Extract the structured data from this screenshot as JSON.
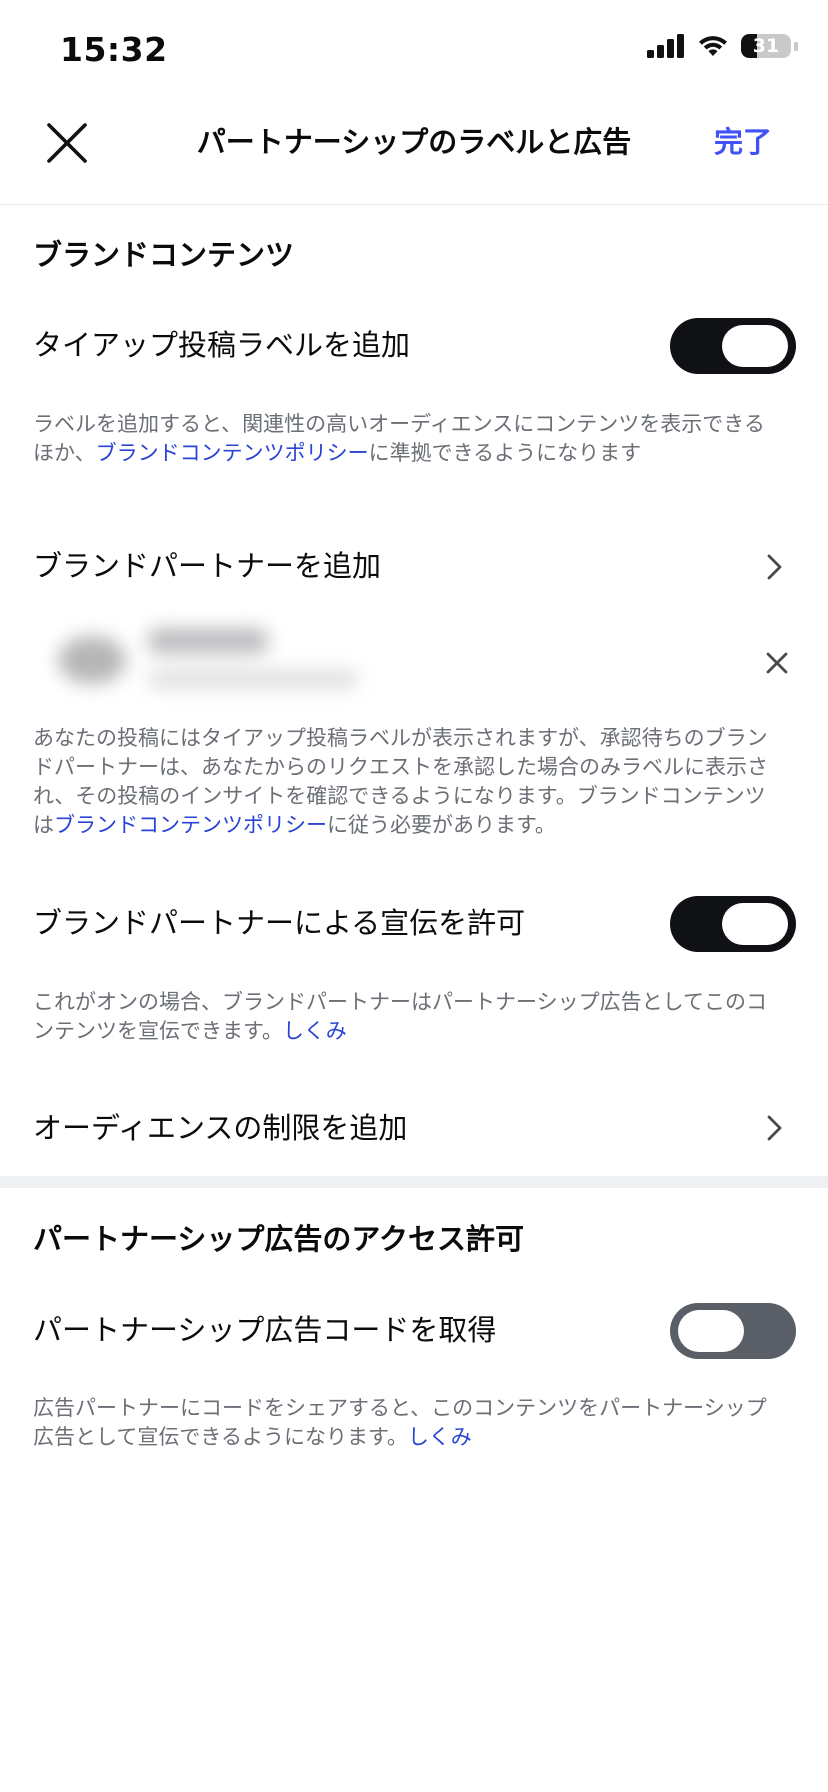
{
  "status_bar": {
    "time": "15:32",
    "battery": "31",
    "battery_level_percent": 31,
    "icons": [
      "signal-icon",
      "wifi-icon",
      "battery-icon"
    ]
  },
  "header": {
    "title": "パートナーシップのラベルと広告",
    "done_label": "完了",
    "close_icon": "close-icon"
  },
  "branded_content": {
    "heading": "ブランドコンテンツ",
    "paid_partnership_label": {
      "label": "タイアップ投稿ラベルを追加",
      "enabled": true,
      "description_before": "ラベルを追加すると、関連性の高いオーディエンスにコンテンツを表示できるほか、",
      "description_link": "ブランドコンテンツポリシー",
      "description_after": "に準拠できるようになります"
    },
    "add_brand_partner": {
      "label": "ブランドパートナーを追加",
      "description_before": "あなたの投稿にはタイアップ投稿ラベルが表示されますが、承認待ちのブランドパートナーは、あなたからのリクエストを承認した場合のみラベルに表示され、その投稿のインサイトを確認できるようになります。ブランドコンテンツは",
      "description_link": "ブランドコンテンツポリシー",
      "description_after": "に従う必要があります。"
    },
    "allow_partner_promotion": {
      "label": "ブランドパートナーによる宣伝を許可",
      "enabled": true,
      "description_before": "これがオンの場合、ブランドパートナーはパートナーシップ広告としてこのコンテンツを宣伝できます。",
      "description_link": "しくみ"
    },
    "audience_restriction": {
      "label": "オーディエンスの制限を追加"
    }
  },
  "partnership_ads": {
    "heading": "パートナーシップ広告のアクセス許可",
    "get_ad_code": {
      "label": "パートナーシップ広告コードを取得",
      "enabled": false,
      "description_before": "広告パートナーにコードをシェアすると、このコンテンツをパートナーシップ広告として宣伝できるようになります。",
      "description_link": "しくみ"
    }
  },
  "colors": {
    "accent": "#4150f7",
    "link": "#2a44d6",
    "toggle_on": "#0f1115",
    "toggle_off": "#5a5e66",
    "secondary_text": "#6b6f76"
  }
}
